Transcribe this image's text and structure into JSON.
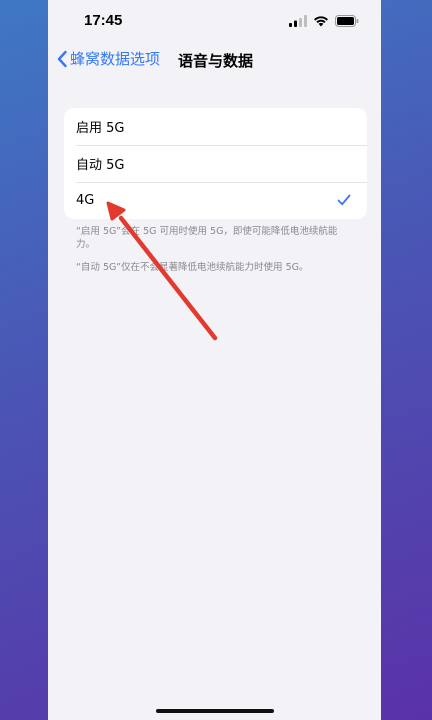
{
  "status": {
    "time": "17:45",
    "icons": [
      "signal-icon",
      "wifi-icon",
      "battery-icon"
    ]
  },
  "nav": {
    "back_label": "蜂窝数据选项",
    "title": "语音与数据"
  },
  "options": [
    {
      "label": "启用 5G",
      "selected": false
    },
    {
      "label": "自动 5G",
      "selected": false
    },
    {
      "label": "4G",
      "selected": true
    }
  ],
  "footnotes": [
    "“启用 5G”会在 5G 可用时使用 5G，即使可能降低电池续航能力。",
    "“自动 5G”仅在不会显著降低电池续航能力时使用 5G。"
  ],
  "colors": {
    "accent": "#3478f6",
    "annotation_arrow": "#e23a2e",
    "background": "#f2f2f7"
  }
}
